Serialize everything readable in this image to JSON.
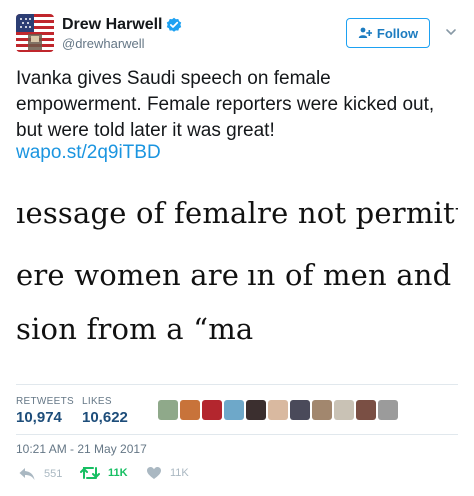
{
  "author": {
    "display_name": "Drew Harwell",
    "handle": "@drewharwell",
    "verified": true
  },
  "follow_button": {
    "label": "Follow"
  },
  "tweet": {
    "text": "Ivanka gives Saudi speech on female empowerment. Female reporters were kicked out, but were told later it was great!",
    "link": "wapo.st/2q9iTBD"
  },
  "attached_image": {
    "lines": [
      "ıessage of femal",
      "re not permitt",
      "ere women are",
      "ın of men and",
      "sion from a “ma"
    ]
  },
  "stats": {
    "retweets_label": "RETWEETS",
    "retweets": "10,974",
    "likes_label": "LIKES",
    "likes": "10,622"
  },
  "timestamp": "10:21 AM - 21 May 2017",
  "actions": {
    "reply_count": "551",
    "retweet_count": "11K",
    "like_count": "11K"
  },
  "colors": {
    "link": "#1b95e0",
    "retweet_green": "#17bf63",
    "muted": "#657786"
  },
  "icons": [
    "flag-avatar",
    "verified-badge-icon",
    "follow-user-icon",
    "chevron-down-icon",
    "reply-icon",
    "retweet-icon",
    "heart-icon"
  ]
}
